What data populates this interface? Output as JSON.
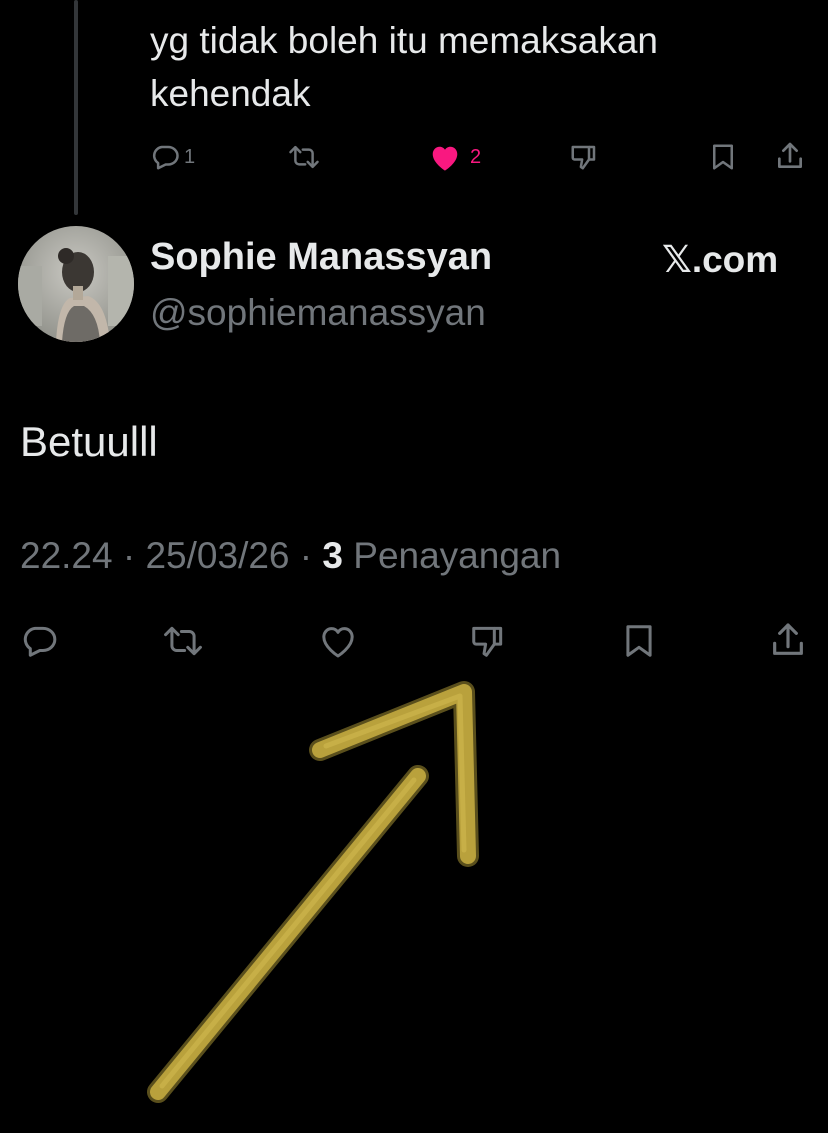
{
  "previous_reply": {
    "text": "yg tidak boleh itu memaksakan kehendak",
    "actions": {
      "reply_count": "1",
      "like_count": "2"
    }
  },
  "tweet": {
    "author_name": "Sophie Manassyan",
    "author_handle": "@sophiemanassyan",
    "brand": "X.com",
    "brand_x": "𝕏",
    "brand_rest": ".com",
    "text": "Betuulll",
    "time": "22.24",
    "date": "25/03/26",
    "views_count": "3",
    "views_label": "Penayangan",
    "separator": "·"
  },
  "icons": {
    "reply": "reply-icon",
    "retweet": "retweet-icon",
    "like": "heart-icon",
    "dislike": "thumbs-down-icon",
    "bookmark": "bookmark-icon",
    "share": "share-icon"
  },
  "colors": {
    "background": "#000000",
    "text_primary": "#e7e9ea",
    "text_secondary": "#71767b",
    "like_active": "#f91880",
    "annotation_arrow": "#b9a13c"
  }
}
